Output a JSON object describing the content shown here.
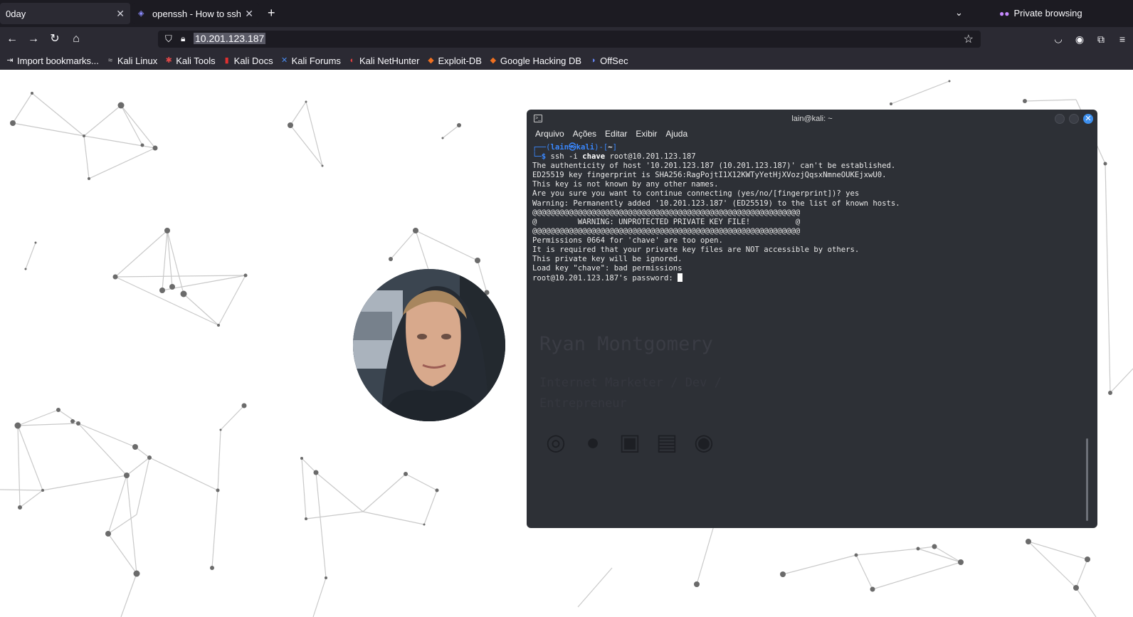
{
  "tabs": [
    {
      "title": "0day",
      "active": false
    },
    {
      "title": "openssh - How to ssh to r",
      "active": true
    }
  ],
  "private_label": "Private browsing",
  "url": "10.201.123.187",
  "bookmarks": [
    {
      "label": "Import bookmarks...",
      "icon": "import-icon"
    },
    {
      "label": "Kali Linux",
      "icon": "kali-dragon-icon"
    },
    {
      "label": "Kali Tools",
      "icon": "kali-tools-icon"
    },
    {
      "label": "Kali Docs",
      "icon": "kali-docs-icon"
    },
    {
      "label": "Kali Forums",
      "icon": "kali-forums-icon"
    },
    {
      "label": "Kali NetHunter",
      "icon": "nethunter-icon"
    },
    {
      "label": "Exploit-DB",
      "icon": "exploitdb-icon"
    },
    {
      "label": "Google Hacking DB",
      "icon": "ghdb-icon"
    },
    {
      "label": "OffSec",
      "icon": "offsec-icon"
    }
  ],
  "terminal": {
    "title": "lain@kali: ~",
    "menu": [
      "Arquivo",
      "Ações",
      "Editar",
      "Exibir",
      "Ajuda"
    ],
    "prompt_user": "lain㉿kali",
    "prompt_dir": "~",
    "command_prefix": "ssh -i ",
    "command_arg": "chave",
    "command_suffix": " root@10.201.123.187",
    "output": [
      "The authenticity of host '10.201.123.187 (10.201.123.187)' can't be established.",
      "ED25519 key fingerprint is SHA256:RagPojtI1X12KWTyYetHjXVozjQqsxNmneOUKEjxwU0.",
      "This key is not known by any other names.",
      "Are you sure you want to continue connecting (yes/no/[fingerprint])? yes",
      "Warning: Permanently added '10.201.123.187' (ED25519) to the list of known hosts.",
      "@@@@@@@@@@@@@@@@@@@@@@@@@@@@@@@@@@@@@@@@@@@@@@@@@@@@@@@@@@@",
      "@         WARNING: UNPROTECTED PRIVATE KEY FILE!          @",
      "@@@@@@@@@@@@@@@@@@@@@@@@@@@@@@@@@@@@@@@@@@@@@@@@@@@@@@@@@@@",
      "Permissions 0664 for 'chave' are too open.",
      "It is required that your private key files are NOT accessible by others.",
      "This private key will be ignored.",
      "Load key \"chave\": bad permissions"
    ],
    "password_prompt": "root@10.201.123.187's password: "
  },
  "page": {
    "name": "Ryan Montgomery",
    "role": "Internet Marketer / Dev / Entrepreneur",
    "socials": [
      "instagram-icon",
      "facebook-icon",
      "twitch-icon",
      "linkedin-icon",
      "github-icon"
    ]
  }
}
